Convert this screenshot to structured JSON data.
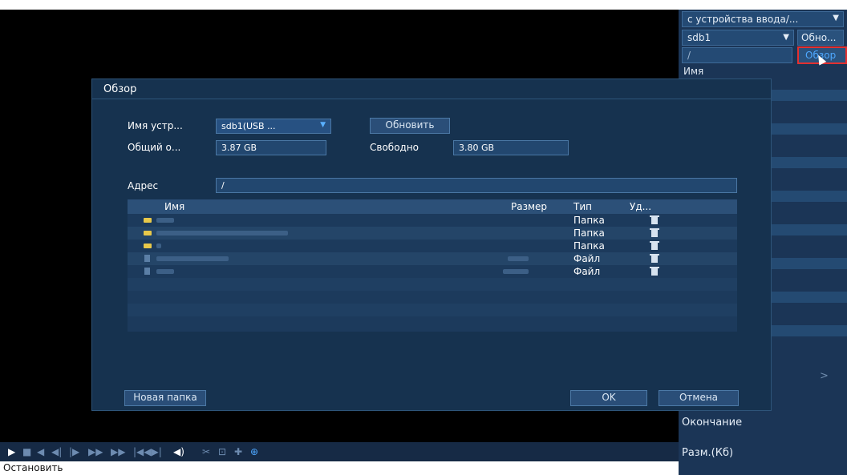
{
  "right_panel": {
    "source_select": "с устройства ввода/...",
    "disk_select": "sdb1",
    "refresh_button": "Обно...",
    "path_value": "/",
    "browse_button": "Обзор",
    "name_header": "Имя",
    "end_label": "Окончание",
    "size_label": "Разм.(Кб)"
  },
  "dialog": {
    "title": "Обзор",
    "device_label": "Имя устр...",
    "device_value": "sdb1(USB ...",
    "refresh_button": "Обновить",
    "total_label": "Общий о...",
    "total_value": "3.87 GB",
    "free_label": "Свободно",
    "free_value": "3.80 GB",
    "address_label": "Адрес",
    "address_value": "/",
    "table": {
      "col_name": "Имя",
      "col_size": "Размер",
      "col_type": "Тип",
      "col_delete": "Уд...",
      "rows": [
        {
          "type": "Папка",
          "icon": "folder-icon"
        },
        {
          "type": "Папка",
          "icon": "folder-icon"
        },
        {
          "type": "Папка",
          "icon": "folder-icon"
        },
        {
          "type": "Файл",
          "icon": "file-icon"
        },
        {
          "type": "Файл",
          "icon": "file-icon"
        }
      ]
    },
    "new_folder_button": "Новая папка",
    "ok_button": "OK",
    "cancel_button": "Отмена"
  },
  "playback": {
    "stop_label": "Остановить",
    "buttons": [
      "play-icon",
      "stop-icon",
      "reverse-play-icon",
      "prev-frame-icon",
      "next-frame-icon",
      "slow-icon",
      "fast-icon",
      "volume-icon",
      "clip-icon",
      "snapshot-icon",
      "tag-icon",
      "zoom-icon"
    ]
  }
}
